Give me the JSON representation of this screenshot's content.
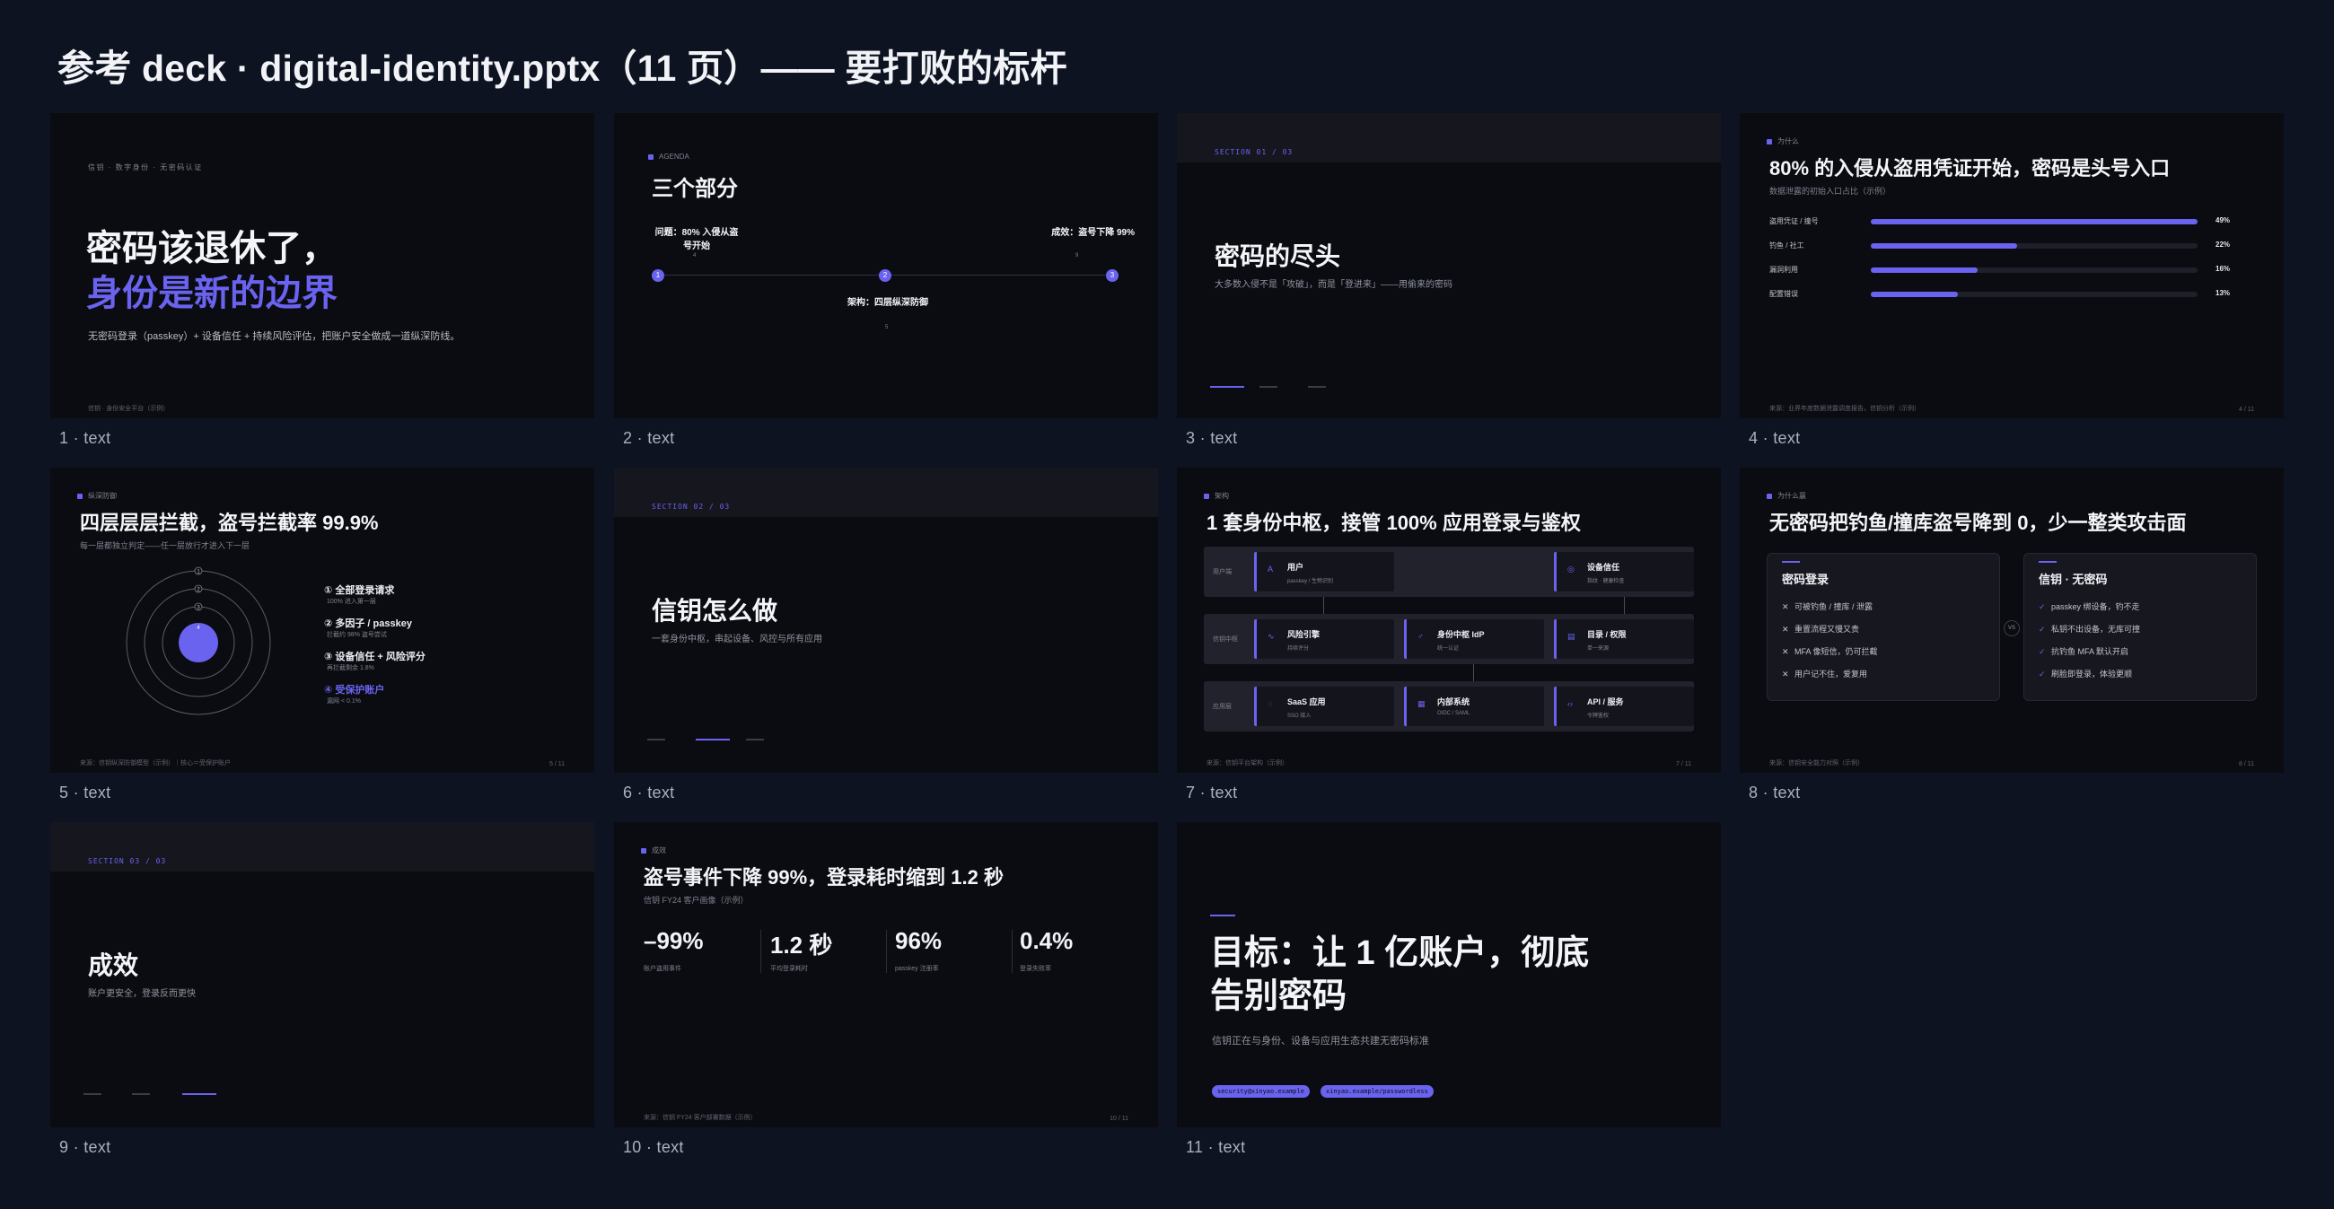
{
  "page_title": "参考 deck · digital-identity.pptx（11 页）—— 要打败的标杆",
  "colors": {
    "background": "#0d1320",
    "slide": "#0b0c11",
    "accent": "#6a63f0"
  },
  "captions": [
    "1 · text",
    "2 · text",
    "3 · text",
    "4 · text",
    "5 · text",
    "6 · text",
    "7 · text",
    "8 · text",
    "9 · text",
    "10 · text",
    "11 · text"
  ],
  "s1": {
    "kicker": "信钥 · 数字身份 · 无密码认证",
    "title1": "密码该退休了，",
    "title2": "身份是新的边界",
    "sub": "无密码登录（passkey）+ 设备信任 + 持续风险评估，把账户安全做成一道纵深防线。",
    "foot": "信钥 · 身份安全平台（示例）"
  },
  "s2": {
    "tag": "AGENDA",
    "title": "三个部分",
    "p1": "问题：80% 入侵从盗号开始",
    "p1n": "4",
    "p2": "架构：四层纵深防御",
    "p2n": "5",
    "p3": "成效：盗号下降 99%",
    "p3n": "9",
    "nums": [
      "1",
      "2",
      "3"
    ]
  },
  "s3": {
    "sec": "SECTION 01 / 03",
    "title": "密码的尽头",
    "sub": "大多数入侵不是「攻破」，而是「登进来」——用偷来的密码"
  },
  "s4": {
    "tag": "为什么",
    "title": "80% 的入侵从盗用凭证开始，密码是头号入口",
    "sub": "数据泄露的初始入口占比（示例）",
    "rows": [
      {
        "label": "盗用凭证 / 撞号",
        "value": 49,
        "text": "49%"
      },
      {
        "label": "钓鱼 / 社工",
        "value": 22,
        "text": "22%"
      },
      {
        "label": "漏洞利用",
        "value": 16,
        "text": "16%"
      },
      {
        "label": "配置错误",
        "value": 13,
        "text": "13%"
      }
    ],
    "foot": "来源：业界年度数据泄露调查报告，信钥分析（示例）",
    "page": "4 / 11"
  },
  "s5": {
    "tag": "纵深防御",
    "title": "四层层层拦截，盗号拦截率 99.9%",
    "sub": "每一层都独立判定——任一层放行才进入下一层",
    "ring_nums": [
      "1",
      "2",
      "3",
      "4"
    ],
    "items": [
      {
        "t": "① 全部登录请求",
        "s": "100% 进入第一层"
      },
      {
        "t": "② 多因子 / passkey",
        "s": "拦截约 98% 盗号尝试"
      },
      {
        "t": "③ 设备信任 + 风险评分",
        "s": "再拦截剩余 1.8%"
      },
      {
        "t": "④ 受保护账户",
        "s": "漏网 < 0.1%"
      }
    ],
    "foot": "来源：信钥纵深防御模型（示例）｜核心＝受保护账户",
    "page": "5 / 11"
  },
  "s6": {
    "sec": "SECTION 02 / 03",
    "title": "信钥怎么做",
    "sub": "一套身份中枢，串起设备、风控与所有应用"
  },
  "s7": {
    "tag": "架构",
    "title": "1 套身份中枢，接管 100% 应用登录与鉴权",
    "rows": [
      {
        "label": "用户端",
        "cells": [
          {
            "t": "用户",
            "s": "passkey / 生物识别",
            "i": "A"
          },
          {
            "t": "设备信任",
            "s": "指纹 · 健康检查",
            "i": "◎"
          }
        ]
      },
      {
        "label": "信钥中枢",
        "cells": [
          {
            "t": "风险引擎",
            "s": "持续评分",
            "i": "∿"
          },
          {
            "t": "身份中枢 IdP",
            "s": "统一认证",
            "i": "♂"
          },
          {
            "t": "目录 / 权限",
            "s": "单一来源",
            "i": "▤"
          }
        ]
      },
      {
        "label": "应用层",
        "cells": [
          {
            "t": "SaaS 应用",
            "s": "SSO 接入",
            "i": "◌"
          },
          {
            "t": "内部系统",
            "s": "OIDC / SAML",
            "i": "▦"
          },
          {
            "t": "API / 服务",
            "s": "令牌鉴权",
            "i": "‹›"
          }
        ]
      }
    ],
    "foot": "来源：信钥平台架构（示例）",
    "page": "7 / 11"
  },
  "s8": {
    "tag": "为什么赢",
    "title": "无密码把钓鱼/撞库盗号降到 0，少一整类攻击面",
    "left": {
      "title": "密码登录",
      "items": [
        "可被钓鱼 / 撞库 / 泄露",
        "重置流程又慢又贵",
        "MFA 像短信，仍可拦截",
        "用户记不住，爱复用"
      ]
    },
    "vs": "VS",
    "right": {
      "title": "信钥 · 无密码",
      "items": [
        "passkey 绑设备，钓不走",
        "私钥不出设备，无库可撞",
        "抗钓鱼 MFA 默认开启",
        "刷脸即登录，体验更顺"
      ]
    },
    "foot": "来源：信钥安全能力对照（示例）",
    "page": "8 / 11"
  },
  "s9": {
    "sec": "SECTION 03 / 03",
    "title": "成效",
    "sub": "账户更安全，登录反而更快"
  },
  "s10": {
    "tag": "成效",
    "title": "盗号事件下降 99%，登录耗时缩到 1.2 秒",
    "sub": "信钥 FY24 客户画像（示例）",
    "kpis": [
      {
        "n": "–99%",
        "l": "账户盗用事件"
      },
      {
        "n": "1.2 秒",
        "l": "平均登录耗时"
      },
      {
        "n": "96%",
        "l": "passkey 注册率"
      },
      {
        "n": "0.4%",
        "l": "登录失败率"
      }
    ],
    "foot": "来源：信钥 FY24 客户部署数据（示例）",
    "page": "10 / 11"
  },
  "s11": {
    "title1": "目标：让 1 亿账户，彻底",
    "title2": "告别密码",
    "sub": "信钥正在与身份、设备与应用生态共建无密码标准",
    "pills": [
      "security@xinyao.example",
      "xinyao.example/passwordless"
    ]
  }
}
